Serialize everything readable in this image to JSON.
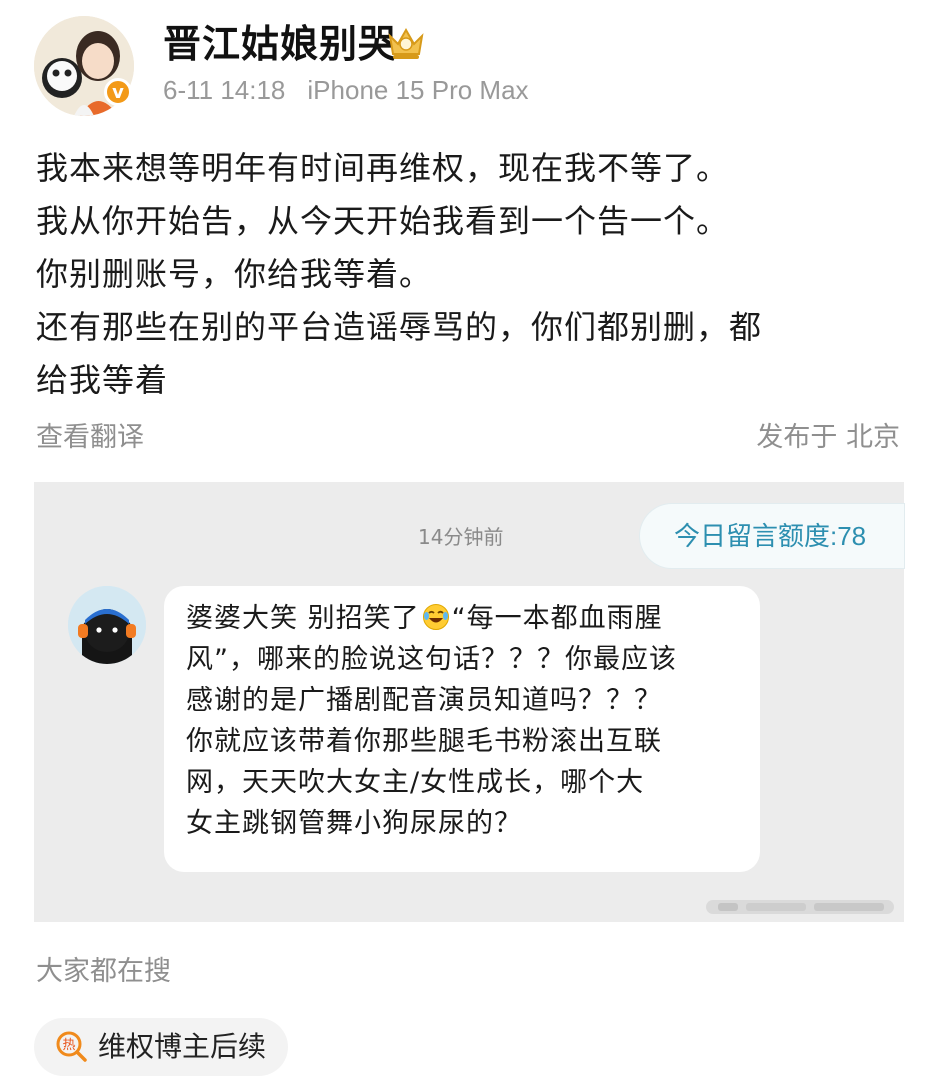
{
  "post": {
    "username": "晋江姑娘别哭",
    "date": "6-11 14:18",
    "device": "iPhone 15 Pro Max",
    "lines": [
      "我本来想等明年有时间再维权，现在我不等了。",
      "我从你开始告，从今天开始我看到一个告一个。",
      "你别删账号，你给我等着。",
      "还有那些在别的平台造谣辱骂的，你们都别删，都",
      "给我等着"
    ],
    "translate_label": "查看翻译",
    "location": "发布于 北京"
  },
  "screenshot": {
    "time": "14分钟前",
    "quota": "今日留言额度:78",
    "comment_lines": [
      {
        "before": "婆婆大笑 别招笑了",
        "emoji": "laughing-tears",
        "after": "“每一本都血雨腥"
      },
      {
        "text": "风”，哪来的脸说这句话？？？你最应该"
      },
      {
        "text": "感谢的是广播剧配音演员知道吗？？？"
      },
      {
        "text": "你就应该带着你那些腿毛书粉滚出互联"
      },
      {
        "text": "网，天天吹大女主/女性成长，哪个大"
      },
      {
        "text": "女主跳钢管舞小狗尿尿的？"
      }
    ]
  },
  "footer": {
    "search_label": "大家都在搜",
    "hot_badge": "热",
    "hot_topic": "维权博主后续"
  },
  "colors": {
    "accent_blue": "#2d8fb0",
    "verified_orange": "#f39a18",
    "muted_gray": "#8f8f8f"
  }
}
